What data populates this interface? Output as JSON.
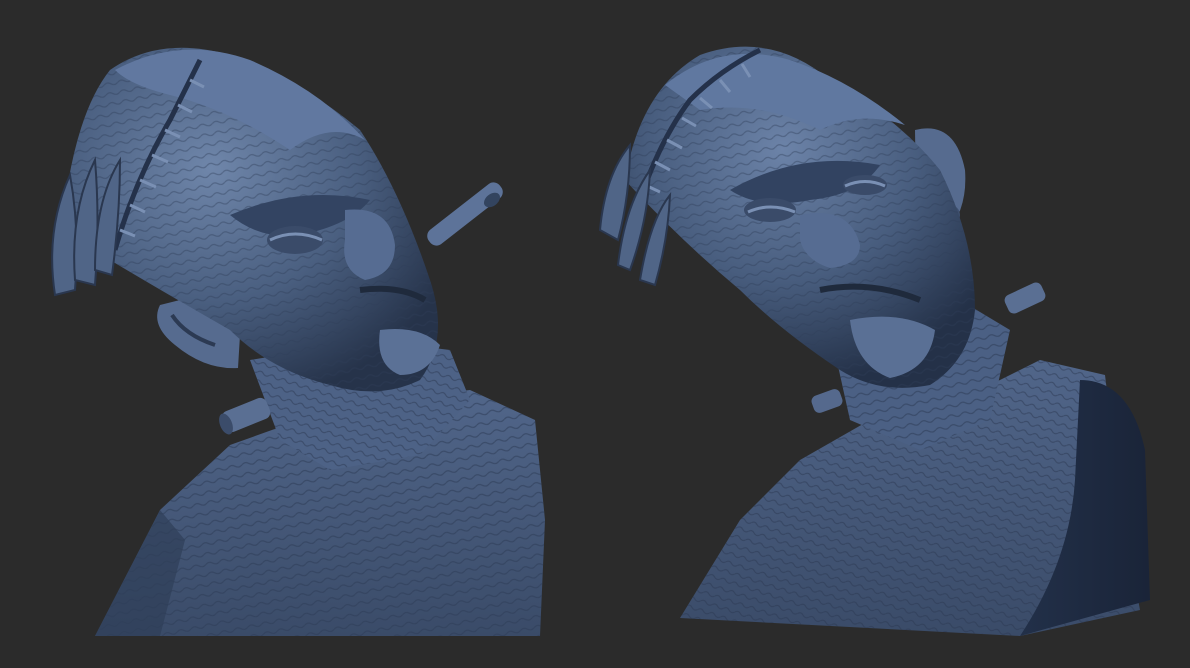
{
  "viewport": {
    "background": "#2b2b2b",
    "material_color": "#4a5f80",
    "highlight_color": "#7d93b6",
    "shadow_color": "#1f2a3c"
  },
  "renders": [
    {
      "name": "sculpt-view-left",
      "subject": "monster-bust",
      "view": "head-tilted-left-with-cigar"
    },
    {
      "name": "sculpt-view-right",
      "subject": "monster-bust",
      "view": "three-quarter-right"
    }
  ]
}
